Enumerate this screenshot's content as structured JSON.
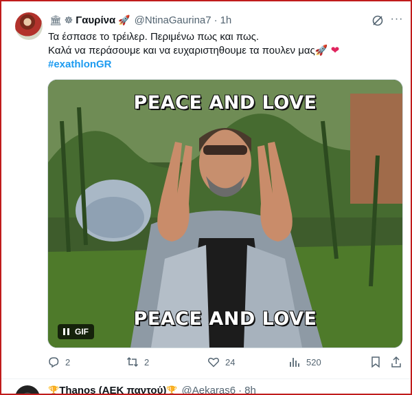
{
  "tweet": {
    "header_icons": "🏛 ☸",
    "display_name": "Γαυρίνα",
    "name_emoji": "🚀",
    "handle": "@NtinaGaurina7",
    "separator": "·",
    "time": "1h",
    "text_line1": "Τα έσπασε το τρέιλερ. Περιμένω πως και πως.",
    "text_line2": "Καλά να περάσουμε και να ευχαριστηθουμε τα πουλεν μας🚀",
    "heart": "❤",
    "hashtag": "#exathlonGR",
    "media": {
      "caption_top": "PEACE AND LOVE",
      "caption_bottom": "PEACE AND LOVE",
      "gif_label": "GIF"
    },
    "actions": {
      "replies": "2",
      "reposts": "2",
      "likes": "24",
      "views": "520"
    }
  },
  "next_tweet": {
    "trophy": "🏆",
    "display_name": "Thanos (ΑΕΚ παντού)",
    "handle": "@Aekaras6",
    "separator": "·",
    "time": "8h"
  },
  "colors": {
    "accent": "#1d9bf0",
    "secondary_text": "#536471",
    "heart": "#e0245e",
    "frame": "#c01c1c"
  }
}
